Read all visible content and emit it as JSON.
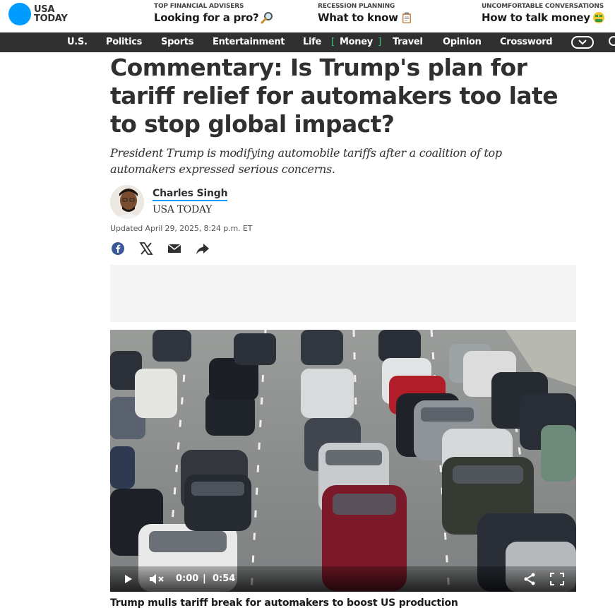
{
  "brand": {
    "line1": "USA",
    "line2": "TODAY",
    "color": "#009bff"
  },
  "promos": [
    {
      "kicker": "TOP FINANCIAL ADVISERS",
      "headline": "Looking for a pro?",
      "icon": "magnifying-glass-emoji"
    },
    {
      "kicker": "RECESSION PLANNING",
      "headline": "What to know",
      "icon": "clipboard-emoji"
    },
    {
      "kicker": "UNCOMFORTABLE CONVERSATIONS",
      "headline": "How to talk money",
      "icon": "money-mouth-face-emoji"
    }
  ],
  "nav": {
    "items": [
      "U.S.",
      "Politics",
      "Sports",
      "Entertainment",
      "Life",
      "Money",
      "Travel",
      "Opinion",
      "Crossword"
    ],
    "active": "Money",
    "bracket_open": "[",
    "bracket_close": "]",
    "accent": "#2ecc71",
    "more_icon": "chevron-down-icon",
    "search_icon": "search-icon"
  },
  "article": {
    "title": "Commentary: Is Trump's plan for tariff relief for automakers too late to stop global impact?",
    "dek": "President Trump is modifying automobile tariffs after a coalition of top automakers expressed serious concerns.",
    "author": "Charles Singh",
    "outlet": "USA TODAY",
    "updated": "Updated April 29, 2025, 8:24 p.m. ET",
    "share_icons": [
      "facebook-icon",
      "x-icon",
      "email-icon",
      "share-arrow-icon"
    ]
  },
  "video": {
    "current_time": "0:00",
    "separator": "|",
    "duration": "0:54",
    "progress": 0,
    "muted": true,
    "caption": "Trump mulls tariff break for automakers to boost US production"
  }
}
